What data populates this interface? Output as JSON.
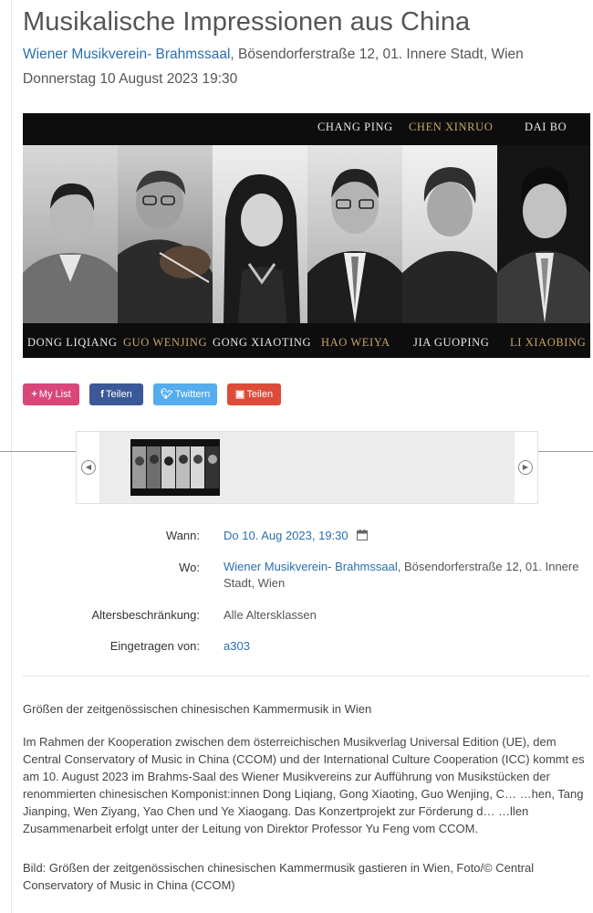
{
  "event": {
    "title": "Musikalische Impressionen aus China",
    "venue_name": "Wiener Musikverein- Brahmssaal",
    "venue_address": ", Bösendorferstraße 12, 01. Innere Stadt, Wien",
    "date_line": "Donnerstag 10 August 2023 19:30"
  },
  "banner": {
    "top_names": [
      "CHANG PING",
      "CHEN XINRUO",
      "DAI BO"
    ],
    "bottom_names": [
      "DONG LIQIANG",
      "GUO WENJING",
      "GONG XIAOTING",
      "HAO WEIYA",
      "JIA GUOPING",
      "LI XIAOBING"
    ],
    "gold_color": "#c9a469"
  },
  "share": {
    "mylist_label": "My List",
    "facebook_label": "Teilen",
    "twitter_label": "Twittern",
    "other_label": "Teilen",
    "colors": {
      "mylist": "#d9467a",
      "facebook": "#3b5998",
      "twitter": "#55acee",
      "other": "#dd4b39"
    }
  },
  "gallery": {
    "prev_icon": "chevron-left-icon",
    "next_icon": "chevron-right-icon"
  },
  "details": {
    "when_label": "Wann:",
    "when_value": "Do 10. Aug 2023, 19:30",
    "where_label": "Wo:",
    "where_link": "Wiener Musikverein- Brahmssaal",
    "where_rest": ", Bösendorferstraße 12, 01. Innere Stadt, Wien",
    "age_label": "Altersbeschränkung:",
    "age_value": "Alle Altersklassen",
    "by_label": "Eingetragen von:",
    "by_value": "a303",
    "calendar_icon": "calendar-icon"
  },
  "description": {
    "headline": "Größen der zeitgenössischen chinesischen Kammermusik in Wien",
    "body": "Im Rahmen der Kooperation zwischen dem österreichischen Musikverlag Universal Edition (UE), dem Central Conservatory of Music in China (CCOM) und der International Culture Cooperation (ICC) kommt es am 10. August 2023 im Brahms-Saal des Wiener Musikvereins zur Aufführung von Musikstücken der renommierten chinesischen Komponist:innen Dong Liqiang, Gong Xiaoting, Guo Wenjing, C… …hen, Tang Jianping, Wen Ziyang, Yao Chen und Ye Xiaogang. Das Konzertprojekt zur Förderung d… …llen Zusammenarbeit erfolgt unter der Leitung von Direktor Professor Yu Feng vom CCOM.",
    "caption": "Bild: Größen der zeitgenössischen chinesischen Kammermusik gastieren in Wien, Foto/© Central Conservatory of Music in China (CCOM)"
  },
  "colors": {
    "link": "#2a6fad",
    "text": "#555555"
  }
}
